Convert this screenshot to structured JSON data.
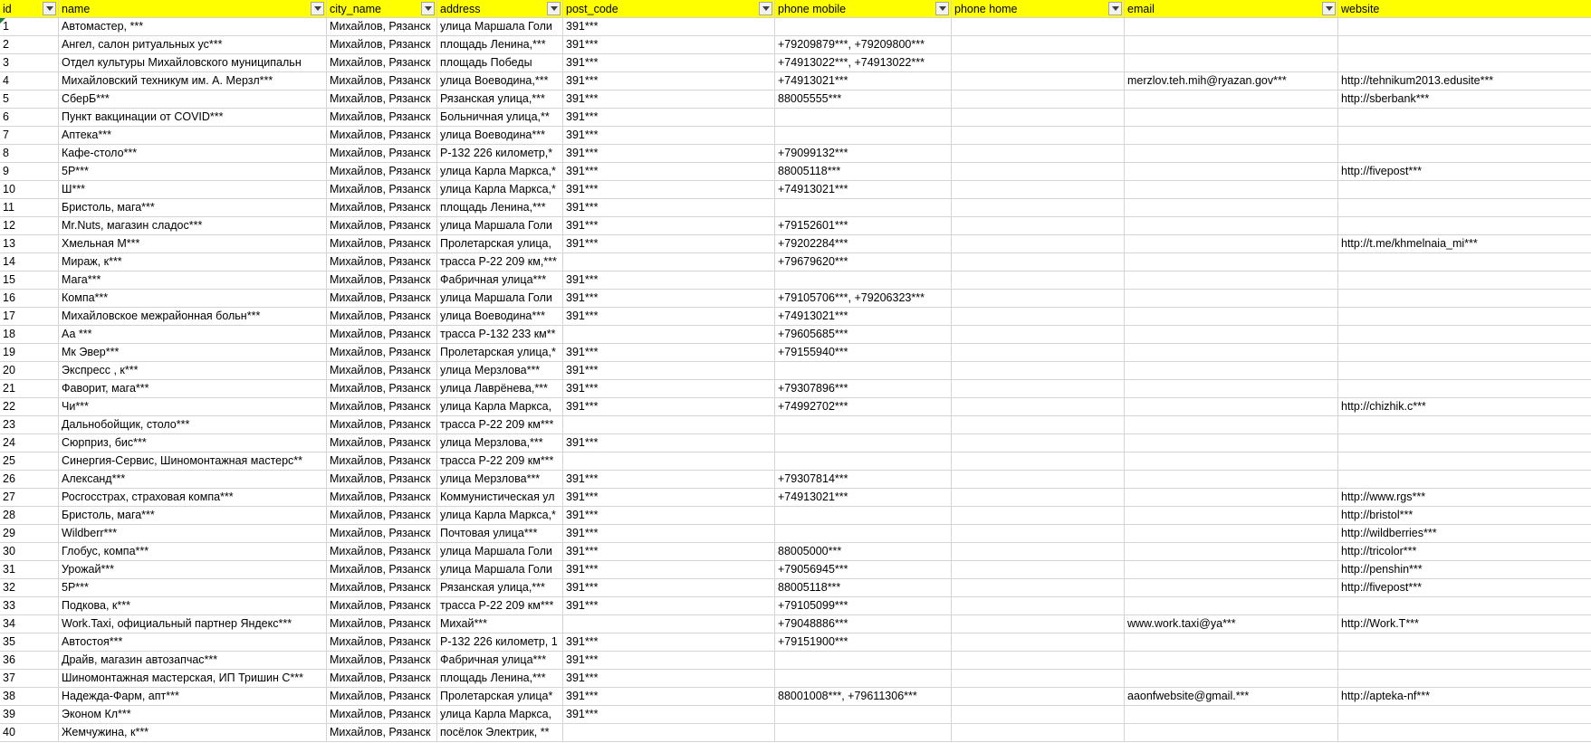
{
  "columns": [
    {
      "key": "id",
      "label": "id"
    },
    {
      "key": "name",
      "label": "name"
    },
    {
      "key": "city",
      "label": "city_name"
    },
    {
      "key": "address",
      "label": "address"
    },
    {
      "key": "post",
      "label": "post_code"
    },
    {
      "key": "mobile",
      "label": "phone mobile"
    },
    {
      "key": "home",
      "label": "phone home"
    },
    {
      "key": "email",
      "label": "email"
    },
    {
      "key": "website",
      "label": "website"
    }
  ],
  "rows": [
    {
      "id": "1",
      "name": "Автомастер, ***",
      "city": "Михайлов, Рязанск",
      "address": "улица Маршала Голи",
      "post": "391***",
      "mobile": "",
      "home": "",
      "email": "",
      "website": ""
    },
    {
      "id": "2",
      "name": "Ангел, салон ритуальных ус***",
      "city": "Михайлов, Рязанск",
      "address": "площадь Ленина,***",
      "post": "391***",
      "mobile": "+79209879***, +79209800***",
      "home": "",
      "email": "",
      "website": ""
    },
    {
      "id": "3",
      "name": "Отдел культуры Михайловского муниципальн",
      "city": "Михайлов, Рязанск",
      "address": "площадь Победы",
      "post": "391***",
      "mobile": "+74913022***, +74913022***",
      "home": "",
      "email": "",
      "website": ""
    },
    {
      "id": "4",
      "name": "Михайловский техникум им. А. Мерзл***",
      "city": "Михайлов, Рязанск",
      "address": "улица Воеводина,***",
      "post": "391***",
      "mobile": "+74913021***",
      "home": "",
      "email": "merzlov.teh.mih@ryazan.gov***",
      "website": "http://tehnikum2013.edusite***"
    },
    {
      "id": "5",
      "name": "СберБ***",
      "city": "Михайлов, Рязанск",
      "address": "Рязанская улица,***",
      "post": "391***",
      "mobile": "88005555***",
      "home": "",
      "email": "",
      "website": "http://sberbank***"
    },
    {
      "id": "6",
      "name": "Пункт вакцинации от COVID***",
      "city": "Михайлов, Рязанск",
      "address": "Больничная улица,**",
      "post": "391***",
      "mobile": "",
      "home": "",
      "email": "",
      "website": ""
    },
    {
      "id": "7",
      "name": "Аптека***",
      "city": "Михайлов, Рязанск",
      "address": "улица Воеводина***",
      "post": "391***",
      "mobile": "",
      "home": "",
      "email": "",
      "website": ""
    },
    {
      "id": "8",
      "name": "Кафе-столо***",
      "city": "Михайлов, Рязанск",
      "address": "Р-132 226 километр,*",
      "post": "391***",
      "mobile": "+79099132***",
      "home": "",
      "email": "",
      "website": ""
    },
    {
      "id": "9",
      "name": "5Р***",
      "city": "Михайлов, Рязанск",
      "address": "улица Карла Маркса,*",
      "post": "391***",
      "mobile": "88005118***",
      "home": "",
      "email": "",
      "website": "http://fivepost***"
    },
    {
      "id": "10",
      "name": "Ш***",
      "city": "Михайлов, Рязанск",
      "address": "улица Карла Маркса,*",
      "post": "391***",
      "mobile": "+74913021***",
      "home": "",
      "email": "",
      "website": ""
    },
    {
      "id": "11",
      "name": "Бристоль, мага***",
      "city": "Михайлов, Рязанск",
      "address": "площадь Ленина,***",
      "post": "391***",
      "mobile": "",
      "home": "",
      "email": "",
      "website": ""
    },
    {
      "id": "12",
      "name": "Mr.Nuts, магазин сладос***",
      "city": "Михайлов, Рязанск",
      "address": "улица Маршала Голи",
      "post": "391***",
      "mobile": "+79152601***",
      "home": "",
      "email": "",
      "website": ""
    },
    {
      "id": "13",
      "name": "Хмельная М***",
      "city": "Михайлов, Рязанск",
      "address": "Пролетарская улица,",
      "post": "391***",
      "mobile": "+79202284***",
      "home": "",
      "email": "",
      "website": "http://t.me/khmelnaia_mi***"
    },
    {
      "id": "14",
      "name": "Мираж, к***",
      "city": "Михайлов, Рязанск",
      "address": "трасса Р-22 209 км,***",
      "post": "",
      "mobile": "+79679620***",
      "home": "",
      "email": "",
      "website": ""
    },
    {
      "id": "15",
      "name": "Мага***",
      "city": "Михайлов, Рязанск",
      "address": "Фабричная улица***",
      "post": "391***",
      "mobile": "",
      "home": "",
      "email": "",
      "website": ""
    },
    {
      "id": "16",
      "name": "Компа***",
      "city": "Михайлов, Рязанск",
      "address": "улица Маршала Голи",
      "post": "391***",
      "mobile": "+79105706***, +79206323***",
      "home": "",
      "email": "",
      "website": ""
    },
    {
      "id": "17",
      "name": "Михайловское межрайонная больн***",
      "city": "Михайлов, Рязанск",
      "address": "улица Воеводина***",
      "post": "391***",
      "mobile": "+74913021***",
      "home": "",
      "email": "",
      "website": ""
    },
    {
      "id": "18",
      "name": "Аа ***",
      "city": "Михайлов, Рязанск",
      "address": "трасса Р-132 233 км**",
      "post": "",
      "mobile": "+79605685***",
      "home": "",
      "email": "",
      "website": ""
    },
    {
      "id": "19",
      "name": "Мк Эвер***",
      "city": "Михайлов, Рязанск",
      "address": "Пролетарская улица,*",
      "post": "391***",
      "mobile": "+79155940***",
      "home": "",
      "email": "",
      "website": ""
    },
    {
      "id": "20",
      "name": "Экспресс , к***",
      "city": "Михайлов, Рязанск",
      "address": "улица Мерзлова***",
      "post": "391***",
      "mobile": "",
      "home": "",
      "email": "",
      "website": ""
    },
    {
      "id": "21",
      "name": "Фаворит, мага***",
      "city": "Михайлов, Рязанск",
      "address": "улица Лаврёнева,***",
      "post": "391***",
      "mobile": "+79307896***",
      "home": "",
      "email": "",
      "website": ""
    },
    {
      "id": "22",
      "name": "Чи***",
      "city": "Михайлов, Рязанск",
      "address": "улица Карла Маркса,",
      "post": "391***",
      "mobile": "+74992702***",
      "home": "",
      "email": "",
      "website": "http://chizhik.c***"
    },
    {
      "id": "23",
      "name": "Дальнобойщик, столо***",
      "city": "Михайлов, Рязанск",
      "address": "трасса Р-22 209 км***",
      "post": "",
      "mobile": "",
      "home": "",
      "email": "",
      "website": ""
    },
    {
      "id": "24",
      "name": "Сюрприз, бис***",
      "city": "Михайлов, Рязанск",
      "address": "улица Мерзлова,***",
      "post": "391***",
      "mobile": "",
      "home": "",
      "email": "",
      "website": ""
    },
    {
      "id": "25",
      "name": "Синергия-Сервис, Шиномонтажная мастерс**",
      "city": "Михайлов, Рязанск",
      "address": "трасса Р-22 209 км***",
      "post": "",
      "mobile": "",
      "home": "",
      "email": "",
      "website": ""
    },
    {
      "id": "26",
      "name": "Александ***",
      "city": "Михайлов, Рязанск",
      "address": "улица Мерзлова***",
      "post": "391***",
      "mobile": "+79307814***",
      "home": "",
      "email": "",
      "website": ""
    },
    {
      "id": "27",
      "name": "Росгосстрах, страховая компа***",
      "city": "Михайлов, Рязанск",
      "address": "Коммунистическая ул",
      "post": "391***",
      "mobile": "+74913021***",
      "home": "",
      "email": "",
      "website": "http://www.rgs***"
    },
    {
      "id": "28",
      "name": "Бристоль, мага***",
      "city": "Михайлов, Рязанск",
      "address": "улица Карла Маркса,*",
      "post": "391***",
      "mobile": "",
      "home": "",
      "email": "",
      "website": "http://bristol***"
    },
    {
      "id": "29",
      "name": "Wildberr***",
      "city": "Михайлов, Рязанск",
      "address": "Почтовая улица***",
      "post": "391***",
      "mobile": "",
      "home": "",
      "email": "",
      "website": "http://wildberries***"
    },
    {
      "id": "30",
      "name": "Глобус, компа***",
      "city": "Михайлов, Рязанск",
      "address": "улица Маршала Голи",
      "post": "391***",
      "mobile": "88005000***",
      "home": "",
      "email": "",
      "website": "http://tricolor***"
    },
    {
      "id": "31",
      "name": "Урожай***",
      "city": "Михайлов, Рязанск",
      "address": "улица Маршала Голи",
      "post": "391***",
      "mobile": "+79056945***",
      "home": "",
      "email": "",
      "website": "http://penshin***"
    },
    {
      "id": "32",
      "name": "5Р***",
      "city": "Михайлов, Рязанск",
      "address": "Рязанская улица,***",
      "post": "391***",
      "mobile": "88005118***",
      "home": "",
      "email": "",
      "website": "http://fivepost***"
    },
    {
      "id": "33",
      "name": "Подкова, к***",
      "city": "Михайлов, Рязанск",
      "address": "трасса Р-22 209 км***",
      "post": "391***",
      "mobile": "+79105099***",
      "home": "",
      "email": "",
      "website": ""
    },
    {
      "id": "34",
      "name": "Work.Taxi, официальный партнер Яндекс***",
      "city": "Михайлов, Рязанск",
      "address": "Михай***",
      "post": "",
      "mobile": "+79048886***",
      "home": "",
      "email": "www.work.taxi@ya***",
      "website": "http://Work.T***"
    },
    {
      "id": "35",
      "name": "Автостоя***",
      "city": "Михайлов, Рязанск",
      "address": "Р-132 226 километр, 1",
      "post": "391***",
      "mobile": "+79151900***",
      "home": "",
      "email": "",
      "website": ""
    },
    {
      "id": "36",
      "name": "Драйв, магазин автозапчас***",
      "city": "Михайлов, Рязанск",
      "address": "Фабричная улица***",
      "post": "391***",
      "mobile": "",
      "home": "",
      "email": "",
      "website": ""
    },
    {
      "id": "37",
      "name": "Шиномонтажная мастерская, ИП Тришин С***",
      "city": "Михайлов, Рязанск",
      "address": "площадь Ленина,***",
      "post": "391***",
      "mobile": "",
      "home": "",
      "email": "",
      "website": ""
    },
    {
      "id": "38",
      "name": "Надежда-Фарм, апт***",
      "city": "Михайлов, Рязанск",
      "address": "Пролетарская улица*",
      "post": "391***",
      "mobile": "88001008***, +79611306***",
      "home": "",
      "email": "aaonfwebsite@gmail.***",
      "website": "http://apteka-nf***"
    },
    {
      "id": "39",
      "name": "Эконом Кл***",
      "city": "Михайлов, Рязанск",
      "address": "улица Карла Маркса,",
      "post": "391***",
      "mobile": "",
      "home": "",
      "email": "",
      "website": ""
    },
    {
      "id": "40",
      "name": "Жемчужина, к***",
      "city": "Михайлов, Рязанск",
      "address": "посёлок Электрик, **",
      "post": "",
      "mobile": "",
      "home": "",
      "email": "",
      "website": ""
    }
  ]
}
